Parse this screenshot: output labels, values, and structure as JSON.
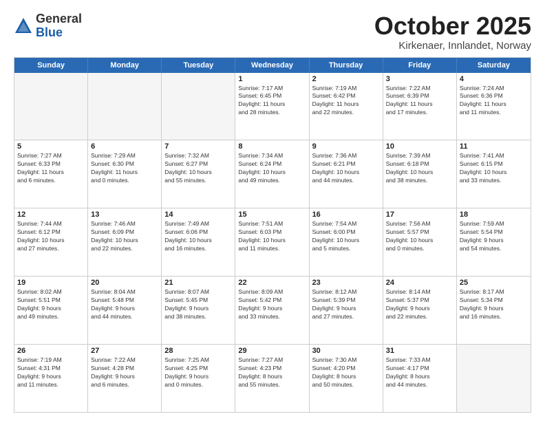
{
  "header": {
    "logo_line1": "General",
    "logo_line2": "Blue",
    "title": "October 2025",
    "subtitle": "Kirkenaer, Innlandet, Norway"
  },
  "weekdays": [
    "Sunday",
    "Monday",
    "Tuesday",
    "Wednesday",
    "Thursday",
    "Friday",
    "Saturday"
  ],
  "weeks": [
    [
      {
        "day": "",
        "info": ""
      },
      {
        "day": "",
        "info": ""
      },
      {
        "day": "",
        "info": ""
      },
      {
        "day": "1",
        "info": "Sunrise: 7:17 AM\nSunset: 6:45 PM\nDaylight: 11 hours\nand 28 minutes."
      },
      {
        "day": "2",
        "info": "Sunrise: 7:19 AM\nSunset: 6:42 PM\nDaylight: 11 hours\nand 22 minutes."
      },
      {
        "day": "3",
        "info": "Sunrise: 7:22 AM\nSunset: 6:39 PM\nDaylight: 11 hours\nand 17 minutes."
      },
      {
        "day": "4",
        "info": "Sunrise: 7:24 AM\nSunset: 6:36 PM\nDaylight: 11 hours\nand 11 minutes."
      }
    ],
    [
      {
        "day": "5",
        "info": "Sunrise: 7:27 AM\nSunset: 6:33 PM\nDaylight: 11 hours\nand 6 minutes."
      },
      {
        "day": "6",
        "info": "Sunrise: 7:29 AM\nSunset: 6:30 PM\nDaylight: 11 hours\nand 0 minutes."
      },
      {
        "day": "7",
        "info": "Sunrise: 7:32 AM\nSunset: 6:27 PM\nDaylight: 10 hours\nand 55 minutes."
      },
      {
        "day": "8",
        "info": "Sunrise: 7:34 AM\nSunset: 6:24 PM\nDaylight: 10 hours\nand 49 minutes."
      },
      {
        "day": "9",
        "info": "Sunrise: 7:36 AM\nSunset: 6:21 PM\nDaylight: 10 hours\nand 44 minutes."
      },
      {
        "day": "10",
        "info": "Sunrise: 7:39 AM\nSunset: 6:18 PM\nDaylight: 10 hours\nand 38 minutes."
      },
      {
        "day": "11",
        "info": "Sunrise: 7:41 AM\nSunset: 6:15 PM\nDaylight: 10 hours\nand 33 minutes."
      }
    ],
    [
      {
        "day": "12",
        "info": "Sunrise: 7:44 AM\nSunset: 6:12 PM\nDaylight: 10 hours\nand 27 minutes."
      },
      {
        "day": "13",
        "info": "Sunrise: 7:46 AM\nSunset: 6:09 PM\nDaylight: 10 hours\nand 22 minutes."
      },
      {
        "day": "14",
        "info": "Sunrise: 7:49 AM\nSunset: 6:06 PM\nDaylight: 10 hours\nand 16 minutes."
      },
      {
        "day": "15",
        "info": "Sunrise: 7:51 AM\nSunset: 6:03 PM\nDaylight: 10 hours\nand 11 minutes."
      },
      {
        "day": "16",
        "info": "Sunrise: 7:54 AM\nSunset: 6:00 PM\nDaylight: 10 hours\nand 5 minutes."
      },
      {
        "day": "17",
        "info": "Sunrise: 7:56 AM\nSunset: 5:57 PM\nDaylight: 10 hours\nand 0 minutes."
      },
      {
        "day": "18",
        "info": "Sunrise: 7:59 AM\nSunset: 5:54 PM\nDaylight: 9 hours\nand 54 minutes."
      }
    ],
    [
      {
        "day": "19",
        "info": "Sunrise: 8:02 AM\nSunset: 5:51 PM\nDaylight: 9 hours\nand 49 minutes."
      },
      {
        "day": "20",
        "info": "Sunrise: 8:04 AM\nSunset: 5:48 PM\nDaylight: 9 hours\nand 44 minutes."
      },
      {
        "day": "21",
        "info": "Sunrise: 8:07 AM\nSunset: 5:45 PM\nDaylight: 9 hours\nand 38 minutes."
      },
      {
        "day": "22",
        "info": "Sunrise: 8:09 AM\nSunset: 5:42 PM\nDaylight: 9 hours\nand 33 minutes."
      },
      {
        "day": "23",
        "info": "Sunrise: 8:12 AM\nSunset: 5:39 PM\nDaylight: 9 hours\nand 27 minutes."
      },
      {
        "day": "24",
        "info": "Sunrise: 8:14 AM\nSunset: 5:37 PM\nDaylight: 9 hours\nand 22 minutes."
      },
      {
        "day": "25",
        "info": "Sunrise: 8:17 AM\nSunset: 5:34 PM\nDaylight: 9 hours\nand 16 minutes."
      }
    ],
    [
      {
        "day": "26",
        "info": "Sunrise: 7:19 AM\nSunset: 4:31 PM\nDaylight: 9 hours\nand 11 minutes."
      },
      {
        "day": "27",
        "info": "Sunrise: 7:22 AM\nSunset: 4:28 PM\nDaylight: 9 hours\nand 6 minutes."
      },
      {
        "day": "28",
        "info": "Sunrise: 7:25 AM\nSunset: 4:25 PM\nDaylight: 9 hours\nand 0 minutes."
      },
      {
        "day": "29",
        "info": "Sunrise: 7:27 AM\nSunset: 4:23 PM\nDaylight: 8 hours\nand 55 minutes."
      },
      {
        "day": "30",
        "info": "Sunrise: 7:30 AM\nSunset: 4:20 PM\nDaylight: 8 hours\nand 50 minutes."
      },
      {
        "day": "31",
        "info": "Sunrise: 7:33 AM\nSunset: 4:17 PM\nDaylight: 8 hours\nand 44 minutes."
      },
      {
        "day": "",
        "info": ""
      }
    ]
  ]
}
